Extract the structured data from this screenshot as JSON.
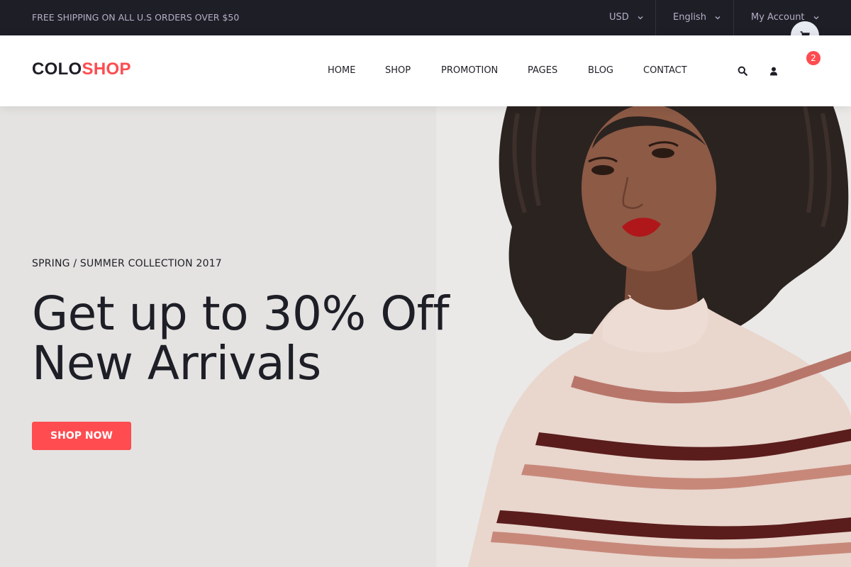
{
  "topbar": {
    "shipping_text": "FREE SHIPPING ON ALL U.S ORDERS OVER $50",
    "currency": "USD",
    "language": "English",
    "account": "My Account"
  },
  "header": {
    "logo_part1": "COLO",
    "logo_part2": "SHOP",
    "nav": [
      "HOME",
      "SHOP",
      "PROMOTION",
      "PAGES",
      "BLOG",
      "CONTACT"
    ],
    "cart_count": "2"
  },
  "hero": {
    "kicker": "SPRING / SUMMER COLLECTION 2017",
    "headline_line1": "Get up to 30% Off",
    "headline_line2": "New Arrivals",
    "cta_label": "SHOP NOW"
  },
  "colors": {
    "accent": "#fe4c50",
    "topbar_bg": "#1e1e27",
    "topbar_text": "#b5aec4",
    "hero_bg": "#e4e3e1",
    "cart_circle": "#e8ebf2"
  },
  "icons": {
    "search": "search-icon",
    "user": "user-icon",
    "cart": "shopping-cart-icon",
    "dropdown": "chevron-down-icon"
  }
}
